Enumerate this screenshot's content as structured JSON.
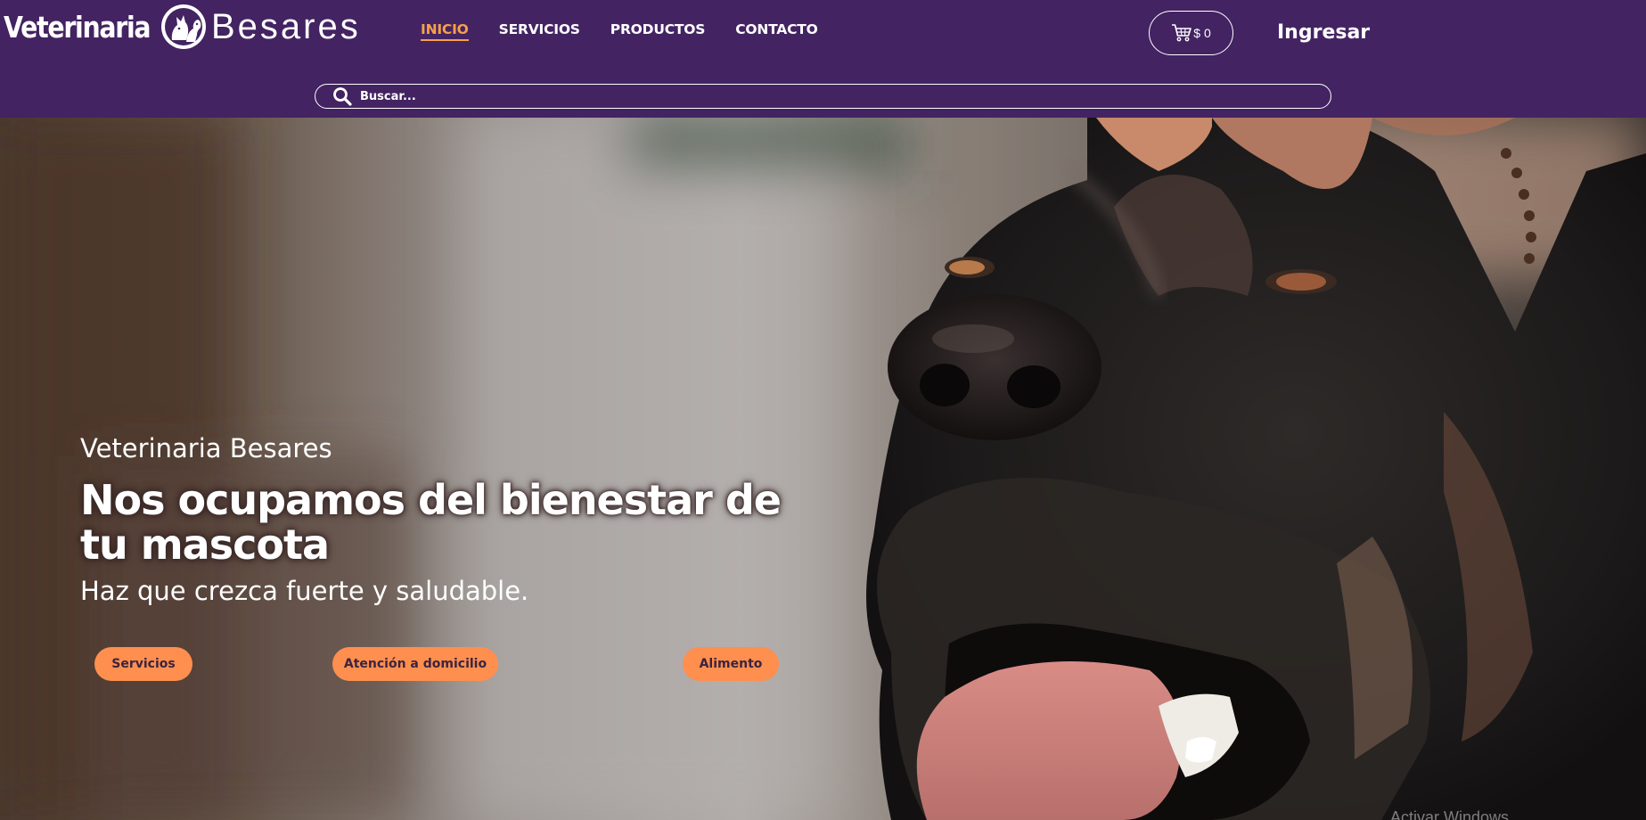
{
  "brand": {
    "word1": "Veterinaria",
    "word2": "Besares",
    "emblem_icon": "cat-and-dog-icon"
  },
  "nav": [
    {
      "label": "INICIO",
      "active": true
    },
    {
      "label": "SERVICIOS",
      "active": false
    },
    {
      "label": "PRODUCTOS",
      "active": false
    },
    {
      "label": "CONTACTO",
      "active": false
    }
  ],
  "cart": {
    "icon": "shopping-cart-icon",
    "amount": "$ 0"
  },
  "login_label": "Ingresar",
  "search": {
    "placeholder": "Buscar...",
    "value": "",
    "icon": "search-icon"
  },
  "hero": {
    "brand": "Veterinaria Besares",
    "headline": "Nos ocupamos del bienestar de tu mascota",
    "subtitle": "Haz que crezca fuerte y saludable.",
    "buttons": [
      {
        "label": "Servicios"
      },
      {
        "label": "Atención a domicilio"
      },
      {
        "label": "Alimento"
      }
    ]
  },
  "watermark": "Activar Windows",
  "colors": {
    "header_bg": "#432362",
    "accent": "#f6a04a",
    "button_bg": "#ff8f4f",
    "button_text": "#3b2440"
  }
}
